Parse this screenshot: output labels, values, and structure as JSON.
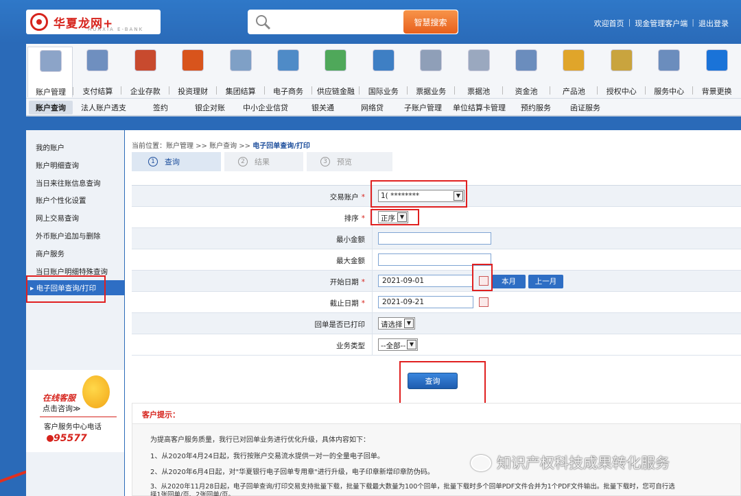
{
  "header": {
    "logo_text": "华夏龙网+",
    "logo_sub": "HUAXIA E-BANK",
    "search_button": "智慧搜索",
    "links": [
      "欢迎首页",
      "现金管理客户端",
      "退出登录"
    ]
  },
  "nav": {
    "items": [
      {
        "label": "账户管理",
        "icon": "magnifier-coins-icon",
        "color": "#8ca4c8"
      },
      {
        "label": "支付结算",
        "icon": "coins-stack-icon",
        "color": "#6f8fbf"
      },
      {
        "label": "企业存款",
        "icon": "piggy-bank-icon",
        "color": "#c84a2e"
      },
      {
        "label": "投资理财",
        "icon": "growth-arrow-icon",
        "color": "#d8541c"
      },
      {
        "label": "集团结算",
        "icon": "gold-bars-icon",
        "color": "#7fa0c6"
      },
      {
        "label": "电子商务",
        "icon": "globe-arrow-icon",
        "color": "#4f8bc7"
      },
      {
        "label": "供应链金融",
        "icon": "recycle-icon",
        "color": "#4fa85a"
      },
      {
        "label": "国际业务",
        "icon": "world-icon",
        "color": "#3e7fc4"
      },
      {
        "label": "票据业务",
        "icon": "documents-icon",
        "color": "#8f9fb8"
      },
      {
        "label": "票据池",
        "icon": "bill-pool-icon",
        "color": "#9aa8bf"
      },
      {
        "label": "资金池",
        "icon": "faucet-icon",
        "color": "#6b8dbd"
      },
      {
        "label": "产品池",
        "icon": "gold-bowl-icon",
        "color": "#e0a52a"
      },
      {
        "label": "授权中心",
        "icon": "padlock-icon",
        "color": "#c9a43e"
      },
      {
        "label": "服务中心",
        "icon": "service-person-icon",
        "color": "#6b8dbd"
      },
      {
        "label": "背景更换",
        "icon": "tshirt-icon",
        "color": "#1a73d8"
      }
    ]
  },
  "subnav": {
    "items": [
      "账户查询",
      "法人账户透支",
      "签约",
      "银企对账",
      "中小企业信贷",
      "银关通",
      "网络贷",
      "子账户管理",
      "单位结算卡管理",
      "预约服务",
      "函证服务"
    ]
  },
  "sidebar": {
    "items": [
      "我的账户",
      "账户明细查询",
      "当日来往账信息查询",
      "账户个性化设置",
      "网上交易查询",
      "外币账户追加与删除",
      "商户服务",
      "当日账户明细特殊查询",
      "电子回单查询/打印"
    ],
    "service": {
      "title": "在线客服",
      "sub": "点击咨询≫",
      "phone_label": "客户服务中心电话",
      "phone": "95577"
    }
  },
  "breadcrumb": {
    "prefix": "当前位置：账户管理 >> 账户查询 >> ",
    "current": "电子回单查询/打印"
  },
  "steps": [
    {
      "num": "1",
      "label": "查询"
    },
    {
      "num": "2",
      "label": "结果"
    },
    {
      "num": "3",
      "label": "预览"
    }
  ],
  "form": {
    "account": {
      "label": "交易账户",
      "value": "1( ********"
    },
    "sort": {
      "label": "排序",
      "value": "正序"
    },
    "min_amount": {
      "label": "最小金额",
      "value": ""
    },
    "max_amount": {
      "label": "最大金额",
      "value": ""
    },
    "start_date": {
      "label": "开始日期",
      "value": "2021-09-01"
    },
    "end_date": {
      "label": "截止日期",
      "value": "2021-09-21"
    },
    "printed": {
      "label": "回单是否已打印",
      "value": "请选择"
    },
    "biz_type": {
      "label": "业务类型",
      "value": "--全部--"
    },
    "this_month": "本月",
    "last_month": "上一月",
    "required_mark": "*",
    "submit": "查询"
  },
  "tips": {
    "title": "客户提示：",
    "lines": [
      "为提高客户服务质量，我行已对回单业务进行优化升级，具体内容如下：",
      "1、从2020年4月24日起，我行按账户交易流水提供一对一的全量电子回单。",
      "2、从2020年6月4日起，对\"华夏银行电子回单专用章\"进行升级，电子印章新增印章防伪码。",
      "3、从2020年11月28日起，电子回单查询/打印交易支持批量下载，批量下载最大数量为100个回单，批量下载时多个回单PDF文件合并为1个PDF文件输出。批量下载时，您可自行选",
      "择1张回单/页、2张回单/页。"
    ]
  },
  "watermark": "知识产权科技成果转化服务"
}
